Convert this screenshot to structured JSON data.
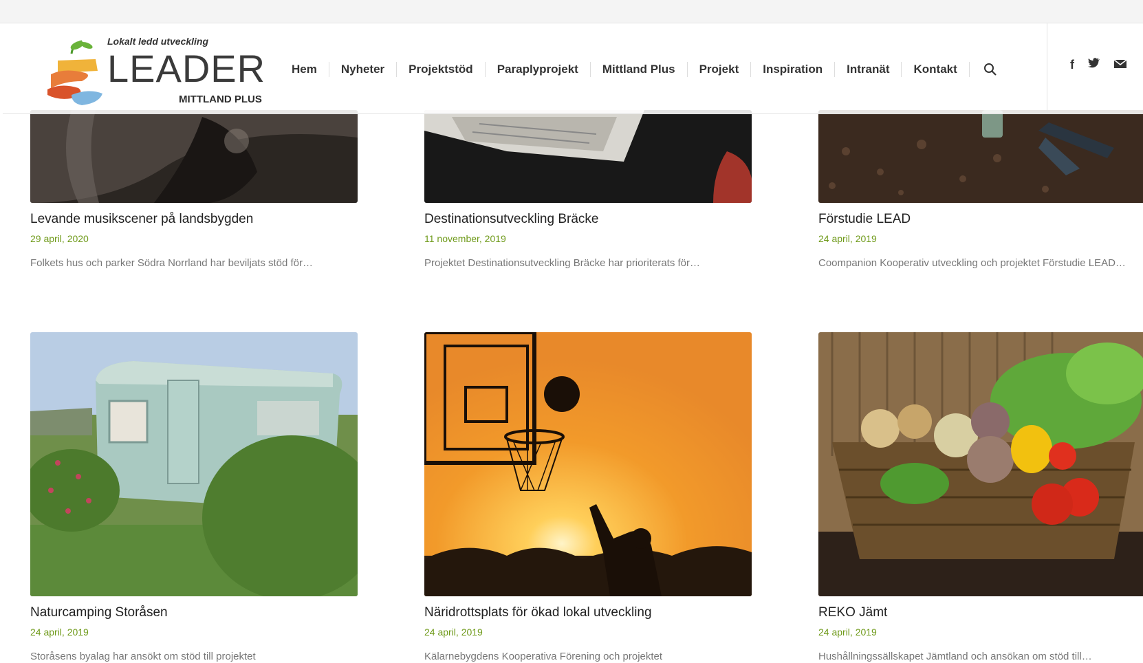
{
  "logo": {
    "tagline": "Lokalt ledd utveckling",
    "wordmark": "LEADER",
    "sub": "MITTLAND PLUS"
  },
  "nav": {
    "items": [
      "Hem",
      "Nyheter",
      "Projektstöd",
      "Paraplyprojekt",
      "Mittland Plus",
      "Projekt",
      "Inspiration",
      "Intranät",
      "Kontakt"
    ],
    "search_icon": "search-icon"
  },
  "social": {
    "facebook": "f",
    "twitter": "twitter-icon",
    "mail": "mail-icon"
  },
  "colors": {
    "date_green": "#6f9a1a",
    "title_dark": "#222222"
  },
  "posts": [
    {
      "title": "Levande musikscener på landsbygden",
      "date": "29 april, 2020",
      "excerpt": "Folkets hus och parker Södra Norrland har beviljats stöd för…"
    },
    {
      "title": "Destinationsutveckling Bräcke",
      "date": "11 november, 2019",
      "excerpt": "Projektet Destinationsutveckling Bräcke har prioriterats för…"
    },
    {
      "title": "Förstudie LEAD",
      "date": "24 april, 2019",
      "excerpt": "Coompanion Kooperativ utveckling och projektet Förstudie LEAD…"
    },
    {
      "title": "Naturcamping Storåsen",
      "date": "24 april, 2019",
      "excerpt": "Storåsens byalag har ansökt om stöd till projektet"
    },
    {
      "title": "Näridrottsplats för ökad lokal utveckling",
      "date": "24 april, 2019",
      "excerpt": "Kälarnebygdens Kooperativa Förening och projektet"
    },
    {
      "title": "REKO Jämt",
      "date": "24 april, 2019",
      "excerpt": "Hushållningssällskapet Jämtland och ansökan om stöd till…"
    }
  ]
}
